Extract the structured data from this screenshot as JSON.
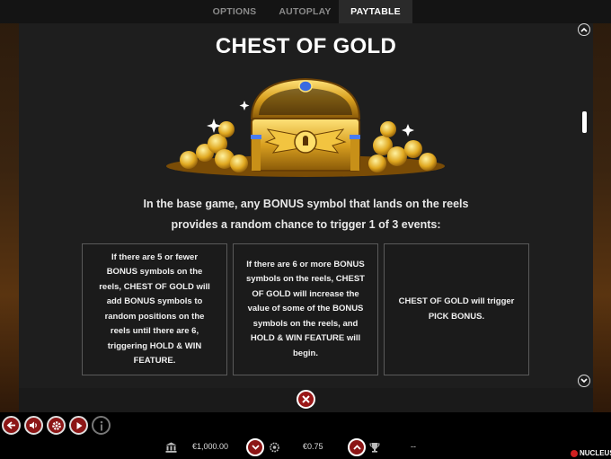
{
  "tabs": [
    {
      "label": "OPTIONS",
      "active": false
    },
    {
      "label": "AUTOPLAY",
      "active": false
    },
    {
      "label": "PAYTABLE",
      "active": true
    }
  ],
  "paytable": {
    "title": "CHEST OF GOLD",
    "description_line1": "In the base game, any BONUS symbol that lands on the reels",
    "description_line2": "provides a random chance to trigger 1 of 3 events:",
    "events": [
      "If there are 5 or fewer BONUS symbols on the reels, CHEST OF GOLD will add BONUS symbols to random positions on the reels until there are 6, triggering HOLD & WIN FEATURE.",
      "If there are 6 or more BONUS symbols on the reels, CHEST OF GOLD will increase the value of some of the BONUS symbols on the reels, and HOLD & WIN FEATURE will begin.",
      "CHEST OF GOLD will trigger PICK BONUS."
    ]
  },
  "bottom_bar": {
    "balance": "€1,000.00",
    "bet": "€0.75",
    "win": "--",
    "brand": "NUCLEUS"
  },
  "colors": {
    "panel_bg": "#1e1e1e",
    "accent_red": "#8c1616",
    "tab_active_bg": "#2a2a2a"
  },
  "icons": [
    "back-arrow-icon",
    "sound-icon",
    "settings-icon",
    "play-icon",
    "info-icon",
    "close-icon",
    "chevron-up-icon",
    "chevron-down-icon",
    "bank-icon",
    "coin-stack-icon",
    "trophy-icon"
  ]
}
